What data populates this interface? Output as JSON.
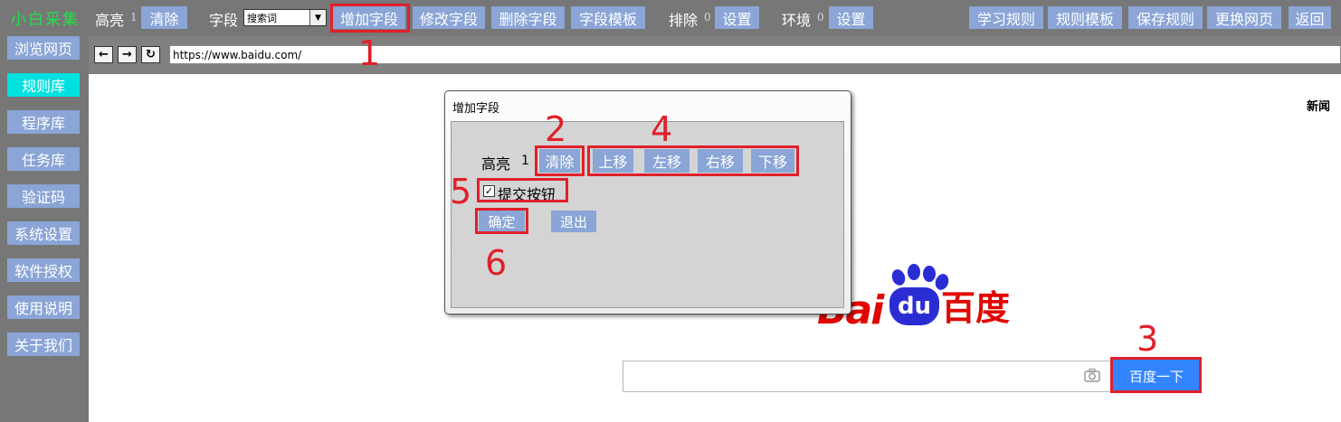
{
  "toolbar": {
    "brand": "小白采集",
    "highlight_label": "高亮",
    "highlight_count": "1",
    "clear": "清除",
    "field_label": "字段",
    "field_select": "搜索词",
    "add_field": "增加字段",
    "edit_field": "修改字段",
    "delete_field": "删除字段",
    "field_template": "字段模板",
    "exclude_label": "排除",
    "exclude_count": "0",
    "exclude_settings": "设置",
    "env_label": "环境",
    "env_count": "0",
    "env_settings": "设置",
    "learn_rules": "学习规则",
    "rule_template": "规则模板",
    "save_rules": "保存规则",
    "change_page": "更换网页",
    "back": "返回"
  },
  "sidebar": {
    "items": [
      {
        "label": "浏览网页",
        "active": false
      },
      {
        "label": "规则库",
        "active": true
      },
      {
        "label": "程序库",
        "active": false
      },
      {
        "label": "任务库",
        "active": false
      },
      {
        "label": "验证码",
        "active": false
      },
      {
        "label": "系统设置",
        "active": false
      },
      {
        "label": "软件授权",
        "active": false
      },
      {
        "label": "使用说明",
        "active": false
      },
      {
        "label": "关于我们",
        "active": false
      }
    ]
  },
  "browser": {
    "back_icon": "arrow-left-icon",
    "forward_icon": "arrow-right-icon",
    "refresh_icon": "refresh-icon",
    "url": "https://www.baidu.com/"
  },
  "page": {
    "news_link": "新闻",
    "logo_bai": "Bai",
    "logo_du": "du",
    "logo_cn": "百度",
    "search_placeholder": "",
    "camera_icon": "camera-icon",
    "search_button": "百度一下"
  },
  "dialog": {
    "title": "增加字段",
    "highlight_label": "高亮",
    "highlight_count": "1",
    "clear": "清除",
    "move_up": "上移",
    "move_left": "左移",
    "move_right": "右移",
    "move_down": "下移",
    "submit_checkbox_label": "提交按钮",
    "submit_checked": true,
    "ok": "确定",
    "exit": "退出"
  },
  "annotations": [
    "1",
    "2",
    "3",
    "4",
    "5",
    "6"
  ],
  "colors": {
    "toolbar_bg": "#777777",
    "button_bg": "#8aa5d6",
    "active_sidebar": "#00e0e0",
    "brand_green": "#23e04a",
    "annotation_red": "#e0202a",
    "baidu_blue": "#3385ff"
  }
}
